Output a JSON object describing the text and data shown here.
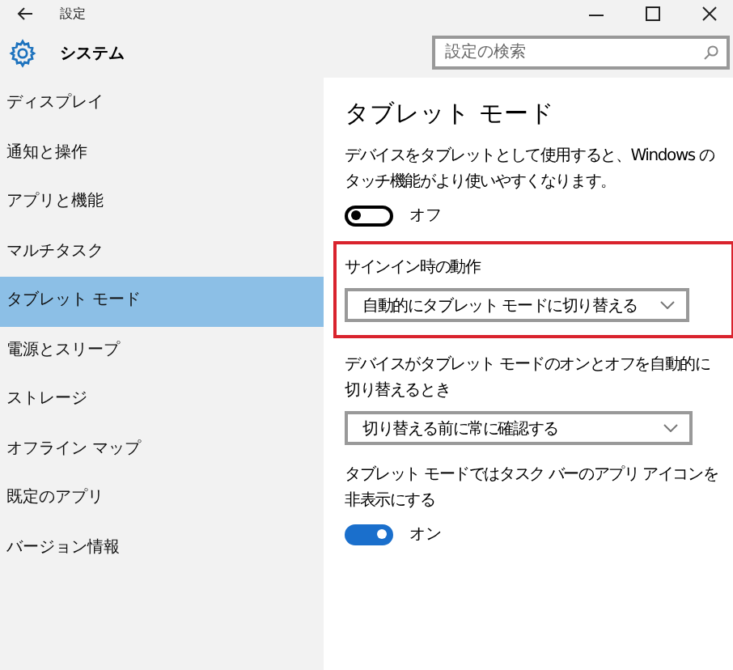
{
  "window": {
    "title": "設定"
  },
  "header": {
    "title": "システム",
    "search": {
      "placeholder": "設定の検索"
    }
  },
  "sidebar": {
    "items": [
      {
        "label": "ディスプレイ",
        "selected": false
      },
      {
        "label": "通知と操作",
        "selected": false
      },
      {
        "label": "アプリと機能",
        "selected": false
      },
      {
        "label": "マルチタスク",
        "selected": false
      },
      {
        "label": "タブレット モード",
        "selected": true
      },
      {
        "label": "電源とスリープ",
        "selected": false
      },
      {
        "label": "ストレージ",
        "selected": false
      },
      {
        "label": "オフライン マップ",
        "selected": false
      },
      {
        "label": "既定のアプリ",
        "selected": false
      },
      {
        "label": "バージョン情報",
        "selected": false
      }
    ]
  },
  "content": {
    "title": "タブレット モード",
    "settings": [
      {
        "kind": "toggle",
        "description": "デバイスをタブレットとして使用すると、Windows のタッチ機能がより使いやすくなります。",
        "on": false,
        "state_label": "オフ"
      },
      {
        "kind": "dropdown",
        "label": "サインイン時の動作",
        "value": "自動的にタブレット モードに切り替える",
        "highlighted": true
      },
      {
        "kind": "dropdown",
        "label": "デバイスがタブレット モードのオンとオフを自動的に切り替えるとき",
        "value": "切り替える前に常に確認する",
        "highlighted": false
      },
      {
        "kind": "toggle",
        "description": "タブレット モードではタスク バーのアプリ アイコンを非表示にする",
        "on": true,
        "state_label": "オン"
      }
    ]
  }
}
